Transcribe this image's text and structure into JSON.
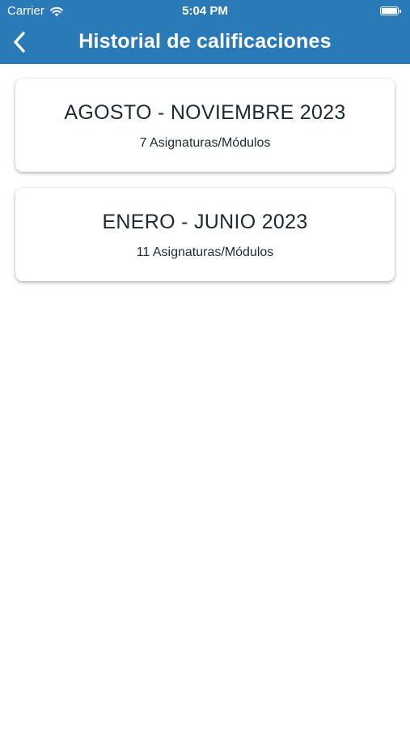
{
  "status_bar": {
    "carrier": "Carrier",
    "time": "5:04 PM",
    "icons": [
      "wifi-icon",
      "battery-icon"
    ]
  },
  "nav": {
    "back_icon": "chevron-left-icon",
    "title": "Historial de calificaciones"
  },
  "periods": [
    {
      "title": "AGOSTO - NOVIEMBRE 2023",
      "subtitle": "7 Asignaturas/Módulos"
    },
    {
      "title": "ENERO - JUNIO 2023",
      "subtitle": "11 Asignaturas/Módulos"
    }
  ],
  "colors": {
    "header": "#2b7ab8",
    "header_text": "#ffffff",
    "card_text": "#1e2a32",
    "background": "#ffffff"
  }
}
